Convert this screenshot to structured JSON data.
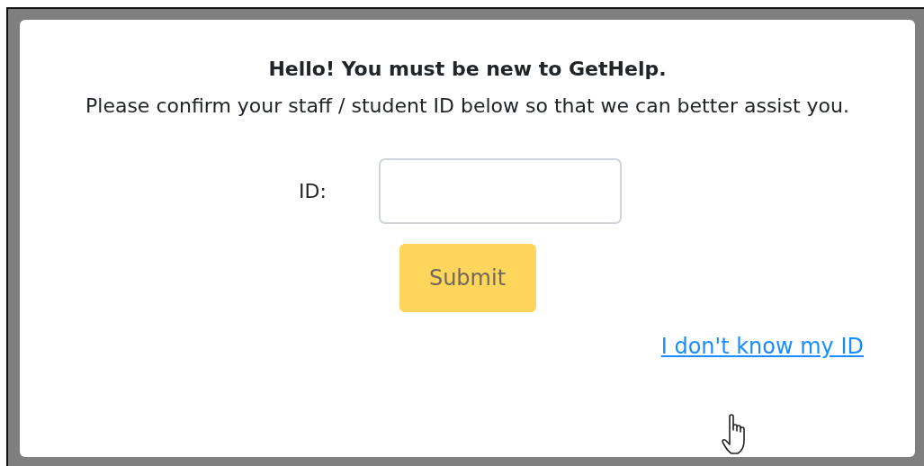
{
  "dialog": {
    "title": "Hello! You must be new to GetHelp.",
    "message": "Please confirm your staff / student ID below so that we can better assist you.",
    "id_field": {
      "label": "ID:"
    },
    "submit_button": {
      "label": "Submit",
      "disabled": true
    },
    "help_link": {
      "label": "I don't know my ID"
    }
  }
}
